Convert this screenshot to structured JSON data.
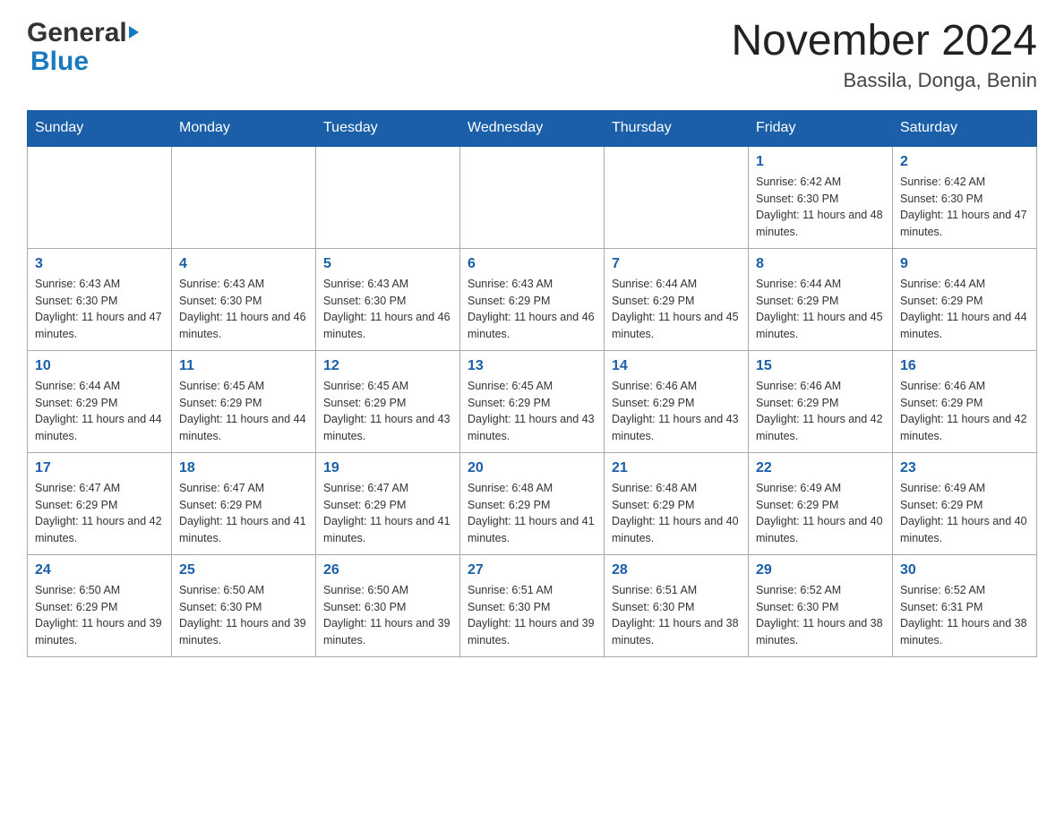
{
  "header": {
    "logo_general": "General",
    "logo_blue": "Blue",
    "month_title": "November 2024",
    "location": "Bassila, Donga, Benin"
  },
  "days_of_week": [
    "Sunday",
    "Monday",
    "Tuesday",
    "Wednesday",
    "Thursday",
    "Friday",
    "Saturday"
  ],
  "weeks": [
    [
      {
        "day": "",
        "info": ""
      },
      {
        "day": "",
        "info": ""
      },
      {
        "day": "",
        "info": ""
      },
      {
        "day": "",
        "info": ""
      },
      {
        "day": "",
        "info": ""
      },
      {
        "day": "1",
        "info": "Sunrise: 6:42 AM\nSunset: 6:30 PM\nDaylight: 11 hours and 48 minutes."
      },
      {
        "day": "2",
        "info": "Sunrise: 6:42 AM\nSunset: 6:30 PM\nDaylight: 11 hours and 47 minutes."
      }
    ],
    [
      {
        "day": "3",
        "info": "Sunrise: 6:43 AM\nSunset: 6:30 PM\nDaylight: 11 hours and 47 minutes."
      },
      {
        "day": "4",
        "info": "Sunrise: 6:43 AM\nSunset: 6:30 PM\nDaylight: 11 hours and 46 minutes."
      },
      {
        "day": "5",
        "info": "Sunrise: 6:43 AM\nSunset: 6:30 PM\nDaylight: 11 hours and 46 minutes."
      },
      {
        "day": "6",
        "info": "Sunrise: 6:43 AM\nSunset: 6:29 PM\nDaylight: 11 hours and 46 minutes."
      },
      {
        "day": "7",
        "info": "Sunrise: 6:44 AM\nSunset: 6:29 PM\nDaylight: 11 hours and 45 minutes."
      },
      {
        "day": "8",
        "info": "Sunrise: 6:44 AM\nSunset: 6:29 PM\nDaylight: 11 hours and 45 minutes."
      },
      {
        "day": "9",
        "info": "Sunrise: 6:44 AM\nSunset: 6:29 PM\nDaylight: 11 hours and 44 minutes."
      }
    ],
    [
      {
        "day": "10",
        "info": "Sunrise: 6:44 AM\nSunset: 6:29 PM\nDaylight: 11 hours and 44 minutes."
      },
      {
        "day": "11",
        "info": "Sunrise: 6:45 AM\nSunset: 6:29 PM\nDaylight: 11 hours and 44 minutes."
      },
      {
        "day": "12",
        "info": "Sunrise: 6:45 AM\nSunset: 6:29 PM\nDaylight: 11 hours and 43 minutes."
      },
      {
        "day": "13",
        "info": "Sunrise: 6:45 AM\nSunset: 6:29 PM\nDaylight: 11 hours and 43 minutes."
      },
      {
        "day": "14",
        "info": "Sunrise: 6:46 AM\nSunset: 6:29 PM\nDaylight: 11 hours and 43 minutes."
      },
      {
        "day": "15",
        "info": "Sunrise: 6:46 AM\nSunset: 6:29 PM\nDaylight: 11 hours and 42 minutes."
      },
      {
        "day": "16",
        "info": "Sunrise: 6:46 AM\nSunset: 6:29 PM\nDaylight: 11 hours and 42 minutes."
      }
    ],
    [
      {
        "day": "17",
        "info": "Sunrise: 6:47 AM\nSunset: 6:29 PM\nDaylight: 11 hours and 42 minutes."
      },
      {
        "day": "18",
        "info": "Sunrise: 6:47 AM\nSunset: 6:29 PM\nDaylight: 11 hours and 41 minutes."
      },
      {
        "day": "19",
        "info": "Sunrise: 6:47 AM\nSunset: 6:29 PM\nDaylight: 11 hours and 41 minutes."
      },
      {
        "day": "20",
        "info": "Sunrise: 6:48 AM\nSunset: 6:29 PM\nDaylight: 11 hours and 41 minutes."
      },
      {
        "day": "21",
        "info": "Sunrise: 6:48 AM\nSunset: 6:29 PM\nDaylight: 11 hours and 40 minutes."
      },
      {
        "day": "22",
        "info": "Sunrise: 6:49 AM\nSunset: 6:29 PM\nDaylight: 11 hours and 40 minutes."
      },
      {
        "day": "23",
        "info": "Sunrise: 6:49 AM\nSunset: 6:29 PM\nDaylight: 11 hours and 40 minutes."
      }
    ],
    [
      {
        "day": "24",
        "info": "Sunrise: 6:50 AM\nSunset: 6:29 PM\nDaylight: 11 hours and 39 minutes."
      },
      {
        "day": "25",
        "info": "Sunrise: 6:50 AM\nSunset: 6:30 PM\nDaylight: 11 hours and 39 minutes."
      },
      {
        "day": "26",
        "info": "Sunrise: 6:50 AM\nSunset: 6:30 PM\nDaylight: 11 hours and 39 minutes."
      },
      {
        "day": "27",
        "info": "Sunrise: 6:51 AM\nSunset: 6:30 PM\nDaylight: 11 hours and 39 minutes."
      },
      {
        "day": "28",
        "info": "Sunrise: 6:51 AM\nSunset: 6:30 PM\nDaylight: 11 hours and 38 minutes."
      },
      {
        "day": "29",
        "info": "Sunrise: 6:52 AM\nSunset: 6:30 PM\nDaylight: 11 hours and 38 minutes."
      },
      {
        "day": "30",
        "info": "Sunrise: 6:52 AM\nSunset: 6:31 PM\nDaylight: 11 hours and 38 minutes."
      }
    ]
  ]
}
